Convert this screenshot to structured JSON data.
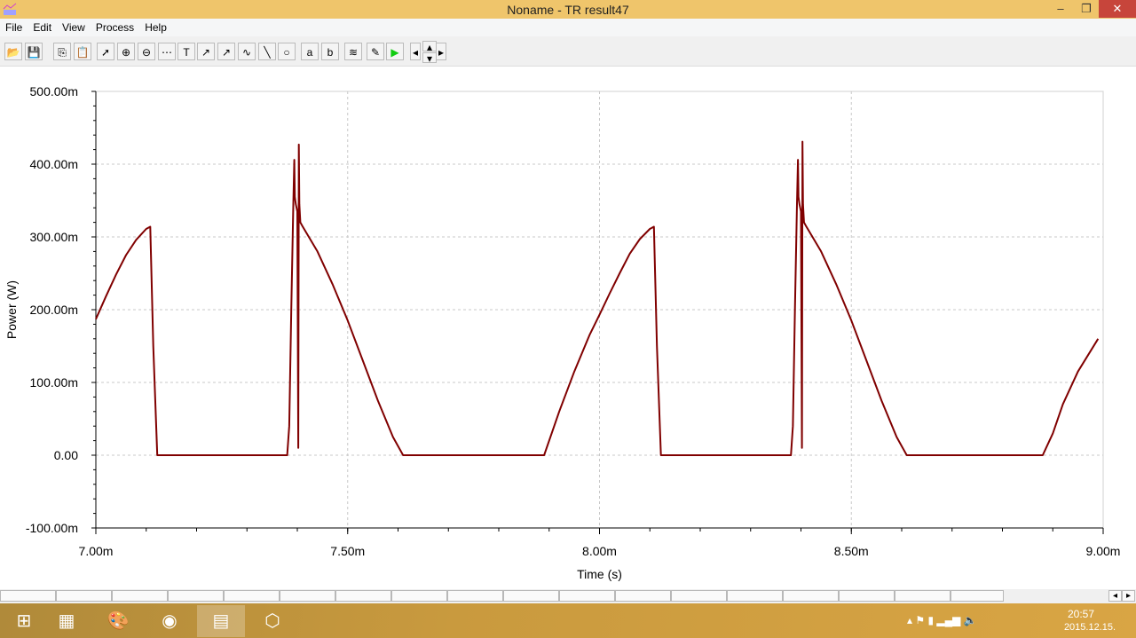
{
  "window": {
    "title": "Noname - TR result47"
  },
  "menu": [
    "File",
    "Edit",
    "View",
    "Process",
    "Help"
  ],
  "toolbar": [
    "open-folder",
    "save",
    "copy",
    "paste",
    "pointer",
    "zoom-in",
    "zoom-100",
    "grid",
    "text",
    "label-1",
    "label-2",
    "legend",
    "line",
    "circle",
    "cursor-a",
    "cursor-b",
    "add-curve",
    "add-probe",
    "run",
    "left",
    "up",
    "down",
    "right"
  ],
  "taskbar": {
    "apps": [
      "start",
      "calculator",
      "paint",
      "firefox",
      "tina",
      "virtualbox"
    ],
    "time": "20:57",
    "date": "2015.12.15."
  },
  "colors": {
    "series": "#800000",
    "titlebar": "#efc56b"
  },
  "chart_data": {
    "type": "line",
    "xlabel": "Time (s)",
    "ylabel": "Power (W)",
    "xlim": [
      7.0,
      9.0
    ],
    "ylim": [
      -100,
      500
    ],
    "x_unit_note": "m",
    "xticks": [
      "7.00m",
      "7.50m",
      "8.00m",
      "8.50m",
      "9.00m"
    ],
    "yticks": [
      "500.00m",
      "400.00m",
      "300.00m",
      "200.00m",
      "100.00m",
      "0.00",
      "-100.00m"
    ],
    "grid": true,
    "series": [
      {
        "x": [
          7.0,
          7.02,
          7.04,
          7.06,
          7.08,
          7.1,
          7.108,
          7.114,
          7.122,
          7.38,
          7.384,
          7.388,
          7.392,
          7.394,
          7.395,
          7.397,
          7.4,
          7.402,
          7.403,
          7.404,
          7.406,
          7.41,
          7.44,
          7.47,
          7.5,
          7.53,
          7.56,
          7.59,
          7.61,
          7.89,
          7.92,
          7.95,
          7.98,
          8.0,
          8.02,
          8.04,
          8.06,
          8.08,
          8.1,
          8.108,
          8.114,
          8.122,
          8.38,
          8.384,
          8.388,
          8.392,
          8.394,
          8.395,
          8.397,
          8.4,
          8.402,
          8.403,
          8.404,
          8.406,
          8.41,
          8.44,
          8.47,
          8.5,
          8.53,
          8.56,
          8.59,
          8.61,
          8.88,
          8.9,
          8.92,
          8.95,
          8.99
        ],
        "y": [
          187,
          218,
          248,
          275,
          296,
          311,
          314,
          150,
          0,
          0,
          40,
          200,
          345,
          406,
          355,
          345,
          335,
          10,
          427,
          345,
          320,
          315,
          280,
          235,
          185,
          130,
          75,
          25,
          0,
          0,
          60,
          115,
          165,
          193,
          222,
          250,
          277,
          297,
          311,
          314,
          150,
          0,
          0,
          40,
          200,
          345,
          406,
          355,
          345,
          335,
          10,
          431,
          345,
          320,
          315,
          280,
          235,
          185,
          130,
          75,
          25,
          0,
          0,
          30,
          70,
          115,
          160
        ]
      }
    ]
  }
}
